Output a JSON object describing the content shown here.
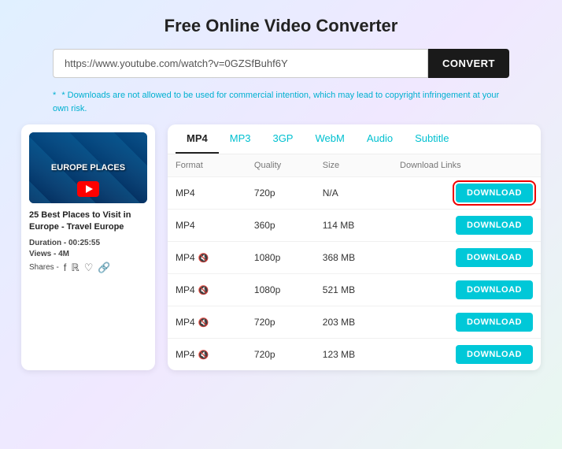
{
  "header": {
    "title": "Free Online Video Converter"
  },
  "search": {
    "url_value": "https://www.youtube.com/watch?v=0GZSfBuhf6Y",
    "convert_label": "CONVERT"
  },
  "disclaimer": "* Downloads are not allowed to be used for commercial intention, which may lead to copyright infringement at your own risk.",
  "video": {
    "title": "25 Best Places to Visit in Europe - Travel Europe",
    "thumbnail_text": "EUROPE\nPLACES",
    "duration_label": "Duration -",
    "duration": "00:25:55",
    "views_label": "Views -",
    "views": "4M",
    "shares_label": "Shares -"
  },
  "tabs": [
    {
      "label": "MP4",
      "active": true
    },
    {
      "label": "MP3",
      "active": false
    },
    {
      "label": "3GP",
      "active": false
    },
    {
      "label": "WebM",
      "active": false
    },
    {
      "label": "Audio",
      "active": false
    },
    {
      "label": "Subtitle",
      "active": false
    }
  ],
  "table": {
    "columns": [
      "Format",
      "Quality",
      "Size",
      "Download Links"
    ],
    "rows": [
      {
        "format": "MP4",
        "has_icon": false,
        "quality": "720p",
        "size": "N/A",
        "highlighted": true
      },
      {
        "format": "MP4",
        "has_icon": false,
        "quality": "360p",
        "size": "114 MB",
        "highlighted": false
      },
      {
        "format": "MP4",
        "has_icon": true,
        "quality": "1080p",
        "size": "368 MB",
        "highlighted": false
      },
      {
        "format": "MP4",
        "has_icon": true,
        "quality": "1080p",
        "size": "521 MB",
        "highlighted": false
      },
      {
        "format": "MP4",
        "has_icon": true,
        "quality": "720p",
        "size": "203 MB",
        "highlighted": false
      },
      {
        "format": "MP4",
        "has_icon": true,
        "quality": "720p",
        "size": "123 MB",
        "highlighted": false
      }
    ],
    "download_label": "DOWNLOAD"
  }
}
